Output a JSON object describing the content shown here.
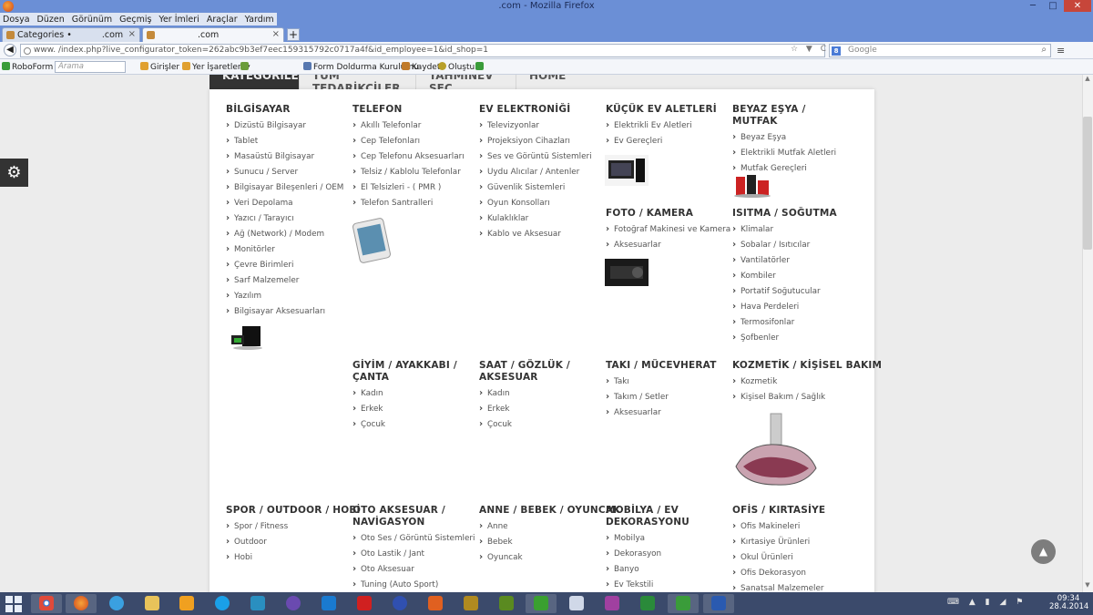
{
  "window": {
    "title": ".com - Mozilla Firefox",
    "minimize": "─",
    "maximize": "□",
    "close": "✕"
  },
  "menubar": [
    "Dosya",
    "Düzen",
    "Görünüm",
    "Geçmiş",
    "Yer İmleri",
    "Araçlar",
    "Yardım"
  ],
  "tabs": [
    {
      "label": "Categories •",
      "suffix": ".com"
    },
    {
      "label": ".com"
    }
  ],
  "tab_close": "×",
  "new_tab": "+",
  "navbar": {
    "back": "◀",
    "url": "www.                                      /index.php?live_configurator_token=262abc9b3ef7eec159315792c0717a4f&id_employee=1&id_shop=1",
    "url_icons": "☆ ▼ C",
    "search_placeholder": "Google",
    "search_engine_icon": "8",
    "search_glass": "⌕",
    "menu": "≡"
  },
  "toolbar": {
    "roboform": "RoboForm",
    "search_placeholder": "Arama",
    "logins": "Girişler",
    "bookmarks": "Yer İşaretleri",
    "form_fill": "Form Doldurma Kurulumu",
    "save": "Kaydet",
    "create": "Oluştur"
  },
  "page": {
    "top_tabs": [
      "KATEGORİLER",
      "TÜM TEDARİKÇİLER",
      "TAHMİNEV SEÇ",
      "HOME"
    ],
    "gear_icon": "⚙",
    "to_top_icon": "▲",
    "categories": [
      {
        "title": "BİLGİSAYAR",
        "items": [
          "Dizüstü Bilgisayar",
          "Tablet",
          "Masaüstü Bilgisayar",
          "Sunucu / Server",
          "Bilgisayar Bileşenleri / OEM",
          "Veri Depolama",
          "Yazıcı / Tarayıcı",
          "Ağ (Network) / Modem",
          "Monitörler",
          "Çevre Birimleri",
          "Sarf Malzemeler",
          "Yazılım",
          "Bilgisayar Aksesuarları"
        ]
      },
      {
        "title": "TELEFON",
        "items": [
          "Akıllı Telefonlar",
          "Cep Telefonları",
          "Cep Telefonu Aksesuarları",
          "Telsiz / Kablolu Telefonlar",
          "El Telsizleri - ( PMR )",
          "Telefon Santralleri"
        ]
      },
      {
        "title": "EV ELEKTRONİĞİ",
        "items": [
          "Televizyonlar",
          "Projeksiyon Cihazları",
          "Ses ve Görüntü Sistemleri",
          "Uydu Alıcılar / Antenler",
          "Güvenlik Sistemleri",
          "Oyun Konsolları",
          "Kulaklıklar",
          "Kablo ve Aksesuar"
        ]
      },
      {
        "title": "KÜÇÜK EV ALETLERİ",
        "items": [
          "Elektrikli Ev Aletleri",
          "Ev Gereçleri"
        ]
      },
      {
        "title": "BEYAZ EŞYA / MUTFAK",
        "items": [
          "Beyaz Eşya",
          "Elektrikli Mutfak Aletleri",
          "Mutfak Gereçleri"
        ]
      },
      {
        "title": "FOTO / KAMERA",
        "items": [
          "Fotoğraf Makinesi ve Kamera",
          "Aksesuarlar"
        ]
      },
      {
        "title": "ISITMA / SOĞUTMA",
        "items": [
          "Klimalar",
          "Sobalar / Isıtıcılar",
          "Vantilatörler",
          "Kombiler",
          "Portatif Soğutucular",
          "Hava Perdeleri",
          "Termosifonlar",
          "Şofbenler"
        ]
      },
      {
        "title": "GİYİM / AYAKKABI / ÇANTA",
        "items": [
          "Kadın",
          "Erkek",
          "Çocuk"
        ]
      },
      {
        "title": "SAAT / GÖZLÜK / AKSESUAR",
        "items": [
          "Kadın",
          "Erkek",
          "Çocuk"
        ]
      },
      {
        "title": "TAKI / MÜCEVHERAT",
        "items": [
          "Takı",
          "Takım / Setler",
          "Aksesuarlar"
        ]
      },
      {
        "title": "KOZMETİK / KİŞİSEL BAKIM",
        "items": [
          "Kozmetik",
          "Kişisel Bakım / Sağlık"
        ]
      },
      {
        "title": "SPOR / OUTDOOR / HOBİ",
        "items": [
          "Spor / Fitness",
          "Outdoor",
          "Hobi"
        ]
      },
      {
        "title": "OTO AKSESUAR / NAVİGASYON",
        "items": [
          "Oto Ses / Görüntü Sistemleri",
          "Oto Lastik / Jant",
          "Oto Aksesuar",
          "Tuning (Auto Sport)"
        ]
      },
      {
        "title": "ANNE / BEBEK / OYUNCAK",
        "items": [
          "Anne",
          "Bebek",
          "Oyuncak"
        ]
      },
      {
        "title": "MOBİLYA / EV DEKORASYONU",
        "items": [
          "Mobilya",
          "Dekorasyon",
          "Banyo",
          "Ev Tekstili"
        ]
      },
      {
        "title": "OFİS / KIRTASİYE",
        "items": [
          "Ofis Makineleri",
          "Kırtasiye Ürünleri",
          "Okul Ürünleri",
          "Ofis Dekorasyon",
          "Sanatsal Malzemeler"
        ]
      }
    ]
  },
  "taskbar": {
    "clock_time": "09:34",
    "clock_date": "28.4.2014",
    "tray": "⌨ ▲ ▮ ◢ ⚑"
  }
}
